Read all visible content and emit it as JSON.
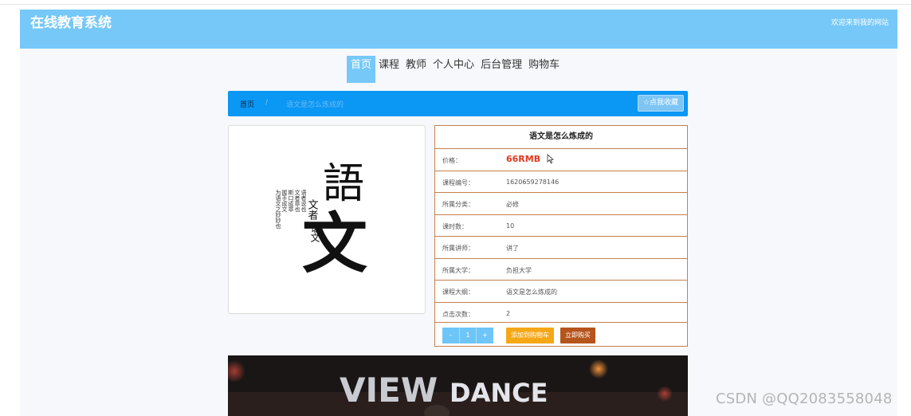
{
  "header": {
    "title": "在线教育系统",
    "welcome": "欢迎来到我的网站"
  },
  "nav": {
    "items": [
      {
        "label": "首页",
        "active": true
      },
      {
        "label": "课程",
        "active": false
      },
      {
        "label": "教师",
        "active": false
      },
      {
        "label": "个人中心",
        "active": false
      },
      {
        "label": "后台管理",
        "active": false
      },
      {
        "label": "购物车",
        "active": false
      }
    ]
  },
  "breadcrumb": {
    "home": "首页",
    "separator": "/",
    "current": "语文是怎么炼成的",
    "favorite_icon": "☆",
    "favorite_label": "点我收藏"
  },
  "cover": {
    "icon": "book-cover-image",
    "big_char_top": "語",
    "big_char_bottom": "文",
    "col_right_1": "文者",
    "col_right_2": "语文",
    "small_columns": [
      "语者说也",
      "文者章也",
      "斯口成章",
      "握手成文",
      "为语文之妙妙也"
    ]
  },
  "course": {
    "title": "语文是怎么炼成的",
    "price_label": "价格：",
    "price": "66RMB",
    "fields": [
      {
        "label": "课程编号：",
        "value": "1620659278146"
      },
      {
        "label": "所属分类：",
        "value": "必修"
      },
      {
        "label": "课时数：",
        "value": "10"
      },
      {
        "label": "所属讲师：",
        "value": "讲了"
      },
      {
        "label": "所属大学：",
        "value": "负担大学"
      },
      {
        "label": "课程大纲：",
        "value": "语文是怎么炼成的"
      },
      {
        "label": "点击次数：",
        "value": "2"
      }
    ]
  },
  "actions": {
    "minus": "-",
    "quantity": "1",
    "plus": "+",
    "add_to_cart": "添加到购物车",
    "buy_now": "立即购买"
  },
  "video": {
    "sign_text_1": "VIEW",
    "sign_text_2": "DANCE"
  },
  "watermark": "CSDN @QQ2083558048",
  "colors": {
    "header": "#76c8f8",
    "breadcrumb_bar": "#0b97f4",
    "price": "#e2381f",
    "cart_button": "#f6a715",
    "buy_button": "#b5541b",
    "table_border": "#c58050"
  }
}
